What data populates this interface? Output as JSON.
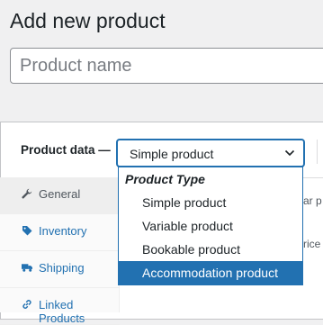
{
  "page": {
    "title": "Add new product"
  },
  "product_name": {
    "value": "",
    "placeholder": "Product name"
  },
  "product_data": {
    "label": "Product data —",
    "selected_type": "Simple product",
    "dropdown": {
      "group_label": "Product Type",
      "options": [
        {
          "label": "Simple product",
          "highlighted": false
        },
        {
          "label": "Variable product",
          "highlighted": false
        },
        {
          "label": "Bookable product",
          "highlighted": false
        },
        {
          "label": "Accommodation product",
          "highlighted": true
        }
      ]
    },
    "tabs": [
      {
        "label": "General",
        "icon": "wrench-icon",
        "active": true
      },
      {
        "label": "Inventory",
        "icon": "tag-icon",
        "active": false
      },
      {
        "label": "Shipping",
        "icon": "truck-icon",
        "active": false
      },
      {
        "label": "Linked Products",
        "icon": "link-icon",
        "active": false
      }
    ],
    "peek_texts": [
      "ar p",
      "rice"
    ]
  },
  "colors": {
    "accent": "#2271b1",
    "link": "#2271b1",
    "text": "#1d2327",
    "background": "#f0f0f1"
  }
}
